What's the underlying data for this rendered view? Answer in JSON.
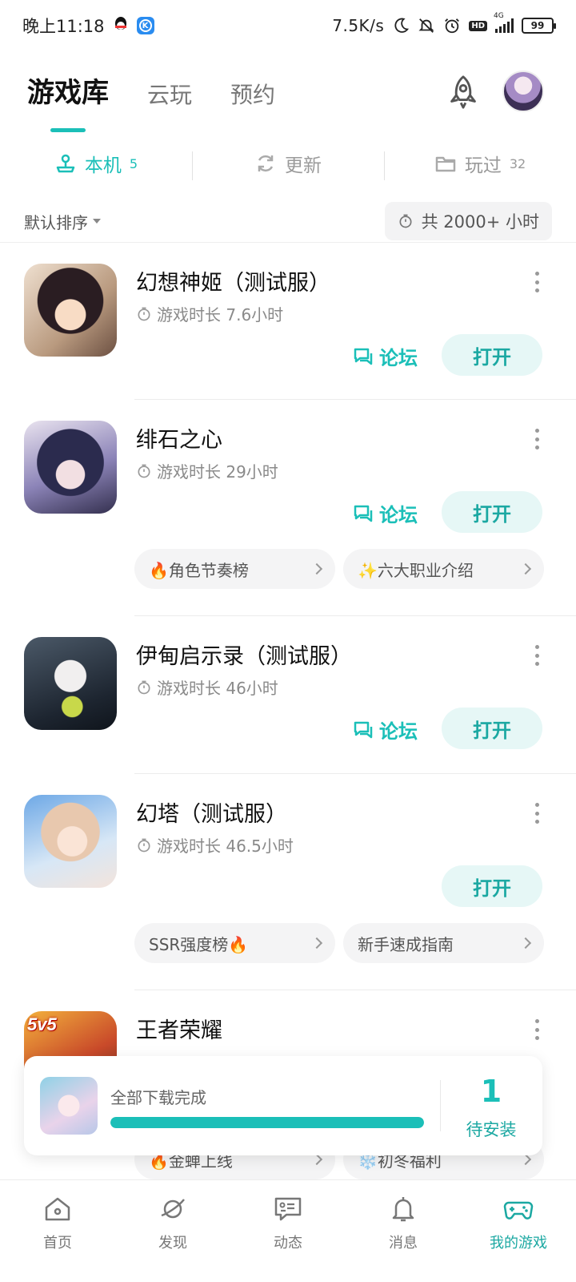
{
  "status_bar": {
    "time": "晚上11:18",
    "speed": "7.5K/s",
    "hd": "HD",
    "network": "4G",
    "battery": "99"
  },
  "top_tabs": [
    {
      "label": "游戏库",
      "active": true
    },
    {
      "label": "云玩",
      "active": false
    },
    {
      "label": "预约",
      "active": false
    }
  ],
  "sub_tabs": [
    {
      "label": "本机",
      "count": "5",
      "icon": "joystick-icon",
      "active": true
    },
    {
      "label": "更新",
      "count": "",
      "icon": "refresh-icon",
      "active": false
    },
    {
      "label": "玩过",
      "count": "32",
      "icon": "folder-icon",
      "active": false
    }
  ],
  "sort": {
    "label": "默认排序",
    "total_time": "共 2000+ 小时"
  },
  "games": [
    {
      "name": "幻想神姬（测试服）",
      "playtime": "游戏时长 7.6小时",
      "forum": "论坛",
      "open": "打开",
      "chips": []
    },
    {
      "name": "绯石之心",
      "playtime": "游戏时长 29小时",
      "forum": "论坛",
      "open": "打开",
      "chips": [
        "🔥角色节奏榜",
        "✨六大职业介绍"
      ]
    },
    {
      "name": "伊甸启示录（测试服）",
      "playtime": "游戏时长 46小时",
      "forum": "论坛",
      "open": "打开",
      "chips": []
    },
    {
      "name": "幻塔（测试服）",
      "playtime": "游戏时长 46.5小时",
      "forum": "",
      "open": "打开",
      "chips": [
        "SSR强度榜🔥",
        "新手速成指南"
      ]
    },
    {
      "name": "王者荣耀",
      "playtime": "",
      "forum": "",
      "open": "",
      "chips": [
        "🔥金蝉上线",
        "❄️初冬福利"
      ],
      "cover_text": "5v5"
    }
  ],
  "download_banner": {
    "title": "全部下载完成",
    "progress": 1.0,
    "count": "1",
    "pending_label": "待安装"
  },
  "bottom_nav": [
    {
      "label": "首页",
      "icon": "home-icon",
      "active": false
    },
    {
      "label": "发现",
      "icon": "discover-icon",
      "active": false
    },
    {
      "label": "动态",
      "icon": "feed-icon",
      "active": false
    },
    {
      "label": "消息",
      "icon": "bell-icon",
      "active": false
    },
    {
      "label": "我的游戏",
      "icon": "gamepad-icon",
      "active": true
    }
  ],
  "colors": {
    "accent": "#1bbfb8",
    "accent_soft": "#e6f7f6"
  }
}
